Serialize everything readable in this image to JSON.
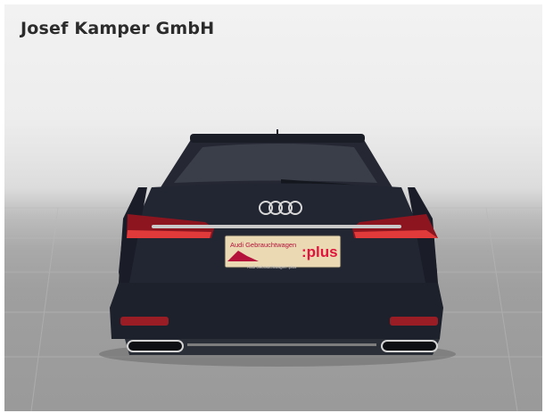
{
  "dealer": {
    "name": "Josef Kamper GmbH"
  },
  "plate": {
    "brand_text": "Audi Gebrauchtwagen",
    "plus_text": ":plus",
    "footer_text": "Audi Gebrauchtwagen :plus"
  },
  "colors": {
    "car_body": "#1f2330",
    "taillight": "#c5202b",
    "plate_background": "#ead9b3",
    "plate_accent": "#e0143c"
  }
}
